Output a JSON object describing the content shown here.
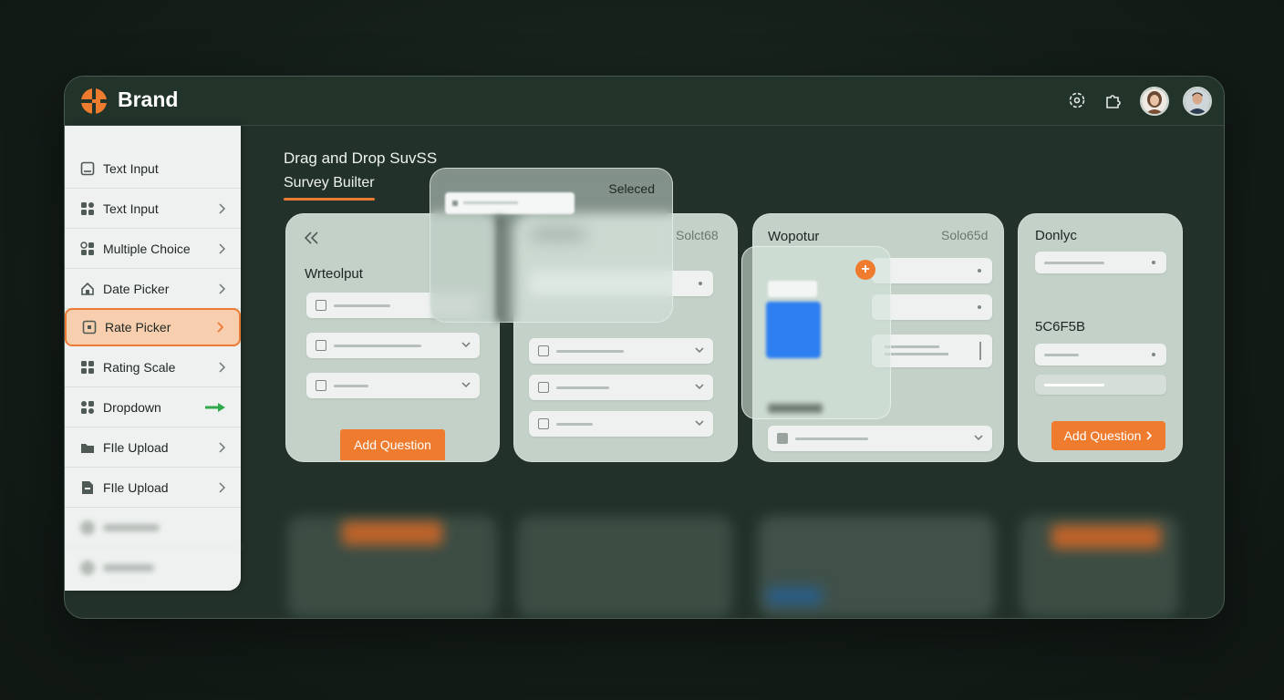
{
  "header": {
    "brand_name": "Brand",
    "brand_color": "#ee7b2e",
    "icons": [
      "settings-icon",
      "puzzle-icon"
    ],
    "avatars": [
      "avatar-woman",
      "avatar-man"
    ]
  },
  "sidebar": {
    "items": [
      {
        "label": "Text Input",
        "icon": "text-input-icon",
        "chevron": false
      },
      {
        "label": "Text Input",
        "icon": "grid-icon",
        "chevron": true
      },
      {
        "label": "Multiple Choice",
        "icon": "choice-icon",
        "chevron": true
      },
      {
        "label": "Date Picker",
        "icon": "home-icon",
        "chevron": true
      },
      {
        "label": "Rate Picker",
        "icon": "square-icon",
        "chevron": true,
        "active": true
      },
      {
        "label": "Rating Scale",
        "icon": "grid-icon",
        "chevron": true
      },
      {
        "label": "Dropdown",
        "icon": "grid-icon",
        "chevron": false,
        "arrow": true
      },
      {
        "label": "FIle Upload",
        "icon": "folder-icon",
        "chevron": true
      },
      {
        "label": "FIle Upload",
        "icon": "file-icon",
        "chevron": true
      }
    ],
    "accent_color": "#ec7a34",
    "arrow_color": "#2eaa4a"
  },
  "main": {
    "title_line1": "Drag and Drop SuvSS",
    "title_line2": "Survey Builter",
    "selected_popup_label": "Seleced",
    "cards": [
      {
        "title": "Wrteolput",
        "status": "",
        "button": "Add Question"
      },
      {
        "title": "",
        "status": "Solct68"
      },
      {
        "title": "Wopotur",
        "status": "Solo65d"
      },
      {
        "title": "Donlyc",
        "status": "",
        "value": "5C6F5B",
        "button": "Add Question"
      }
    ]
  }
}
